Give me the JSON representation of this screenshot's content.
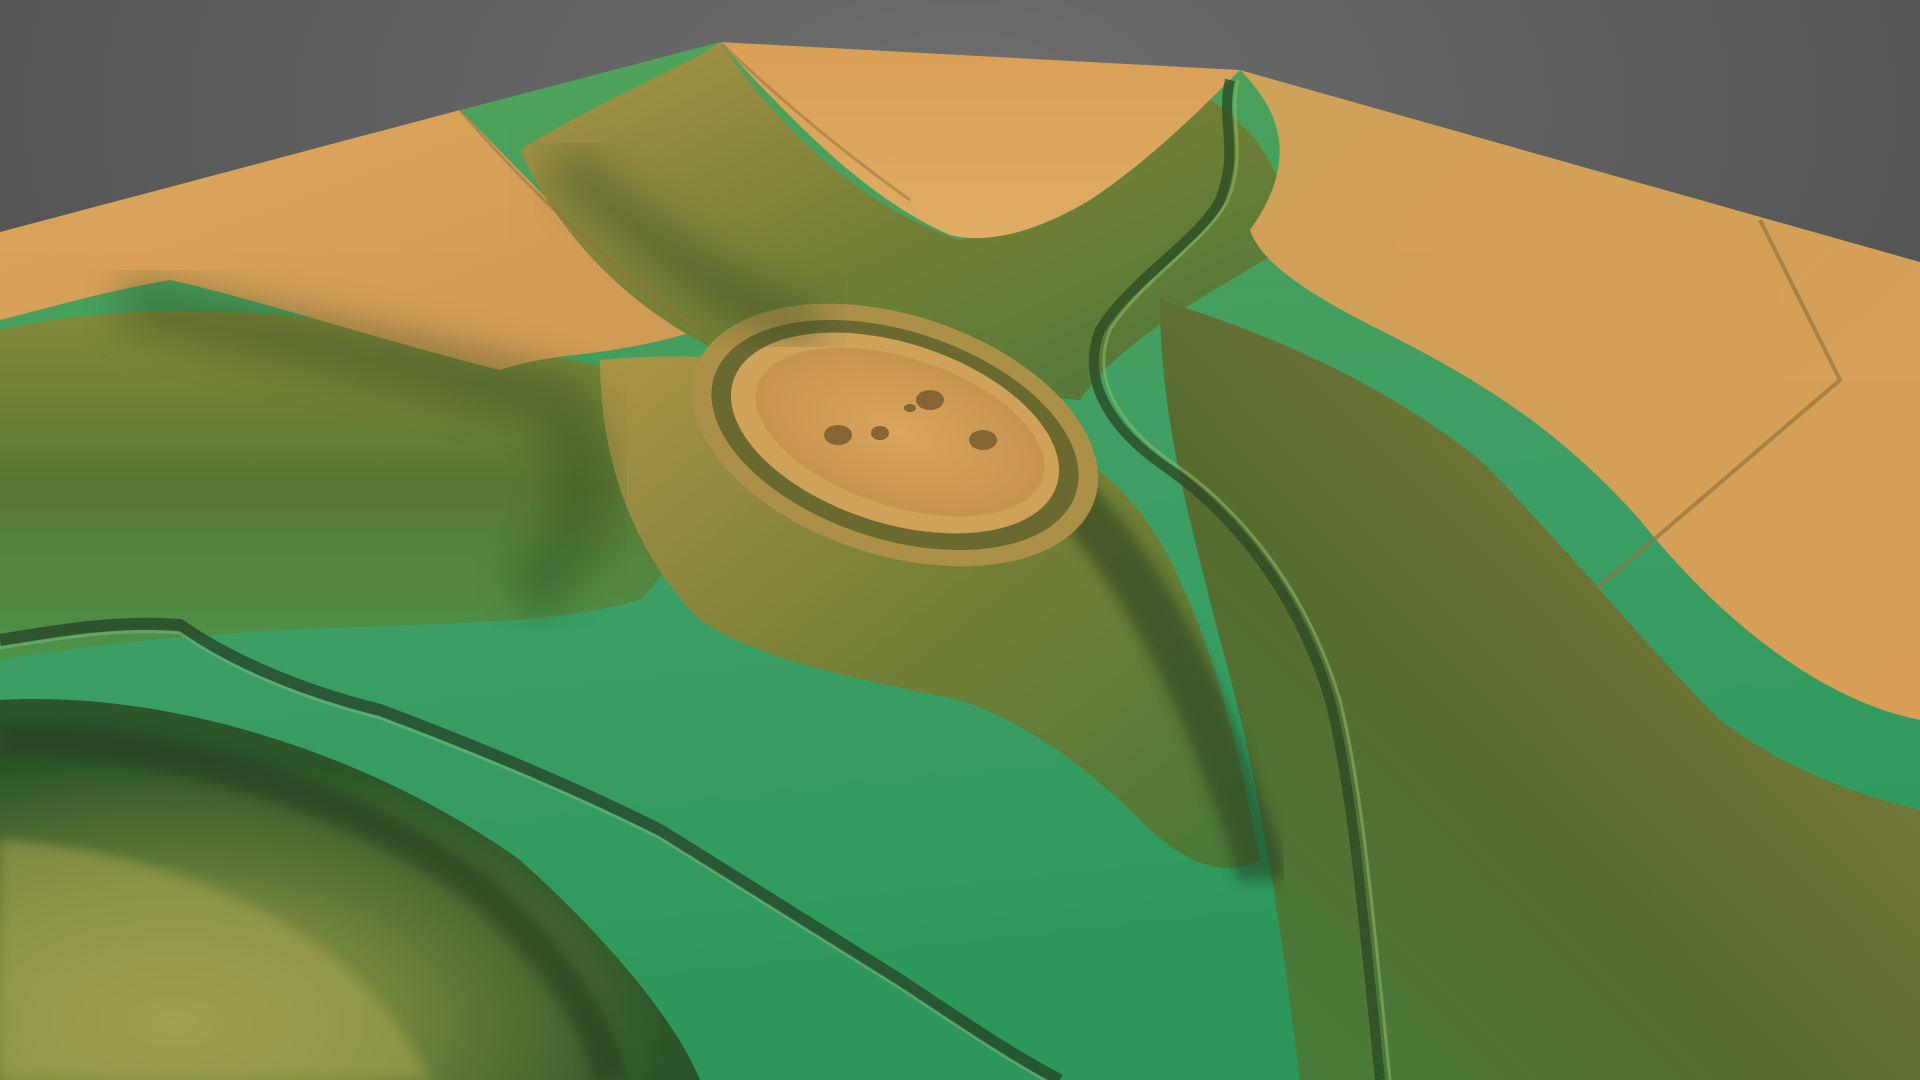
{
  "scene": {
    "background_color": "#4a4a4a",
    "background_highlight": "#6e6e6e"
  },
  "terrain": {
    "render_style": "shaded-relief elevation model",
    "color_ramp": {
      "high": "#e2a659",
      "upper_mid": "#c8a14f",
      "mid": "#8b8f3c",
      "lower_mid": "#4f9a4e",
      "low": "#3ea66a",
      "shadow": "#24391f"
    },
    "features": [
      "plateau-northwest",
      "plateau-north",
      "plateau-east",
      "central-ridge",
      "enclosure-bank",
      "enclosure-interior",
      "valley-floor",
      "stream-channel",
      "lower-hill-southwest"
    ]
  }
}
